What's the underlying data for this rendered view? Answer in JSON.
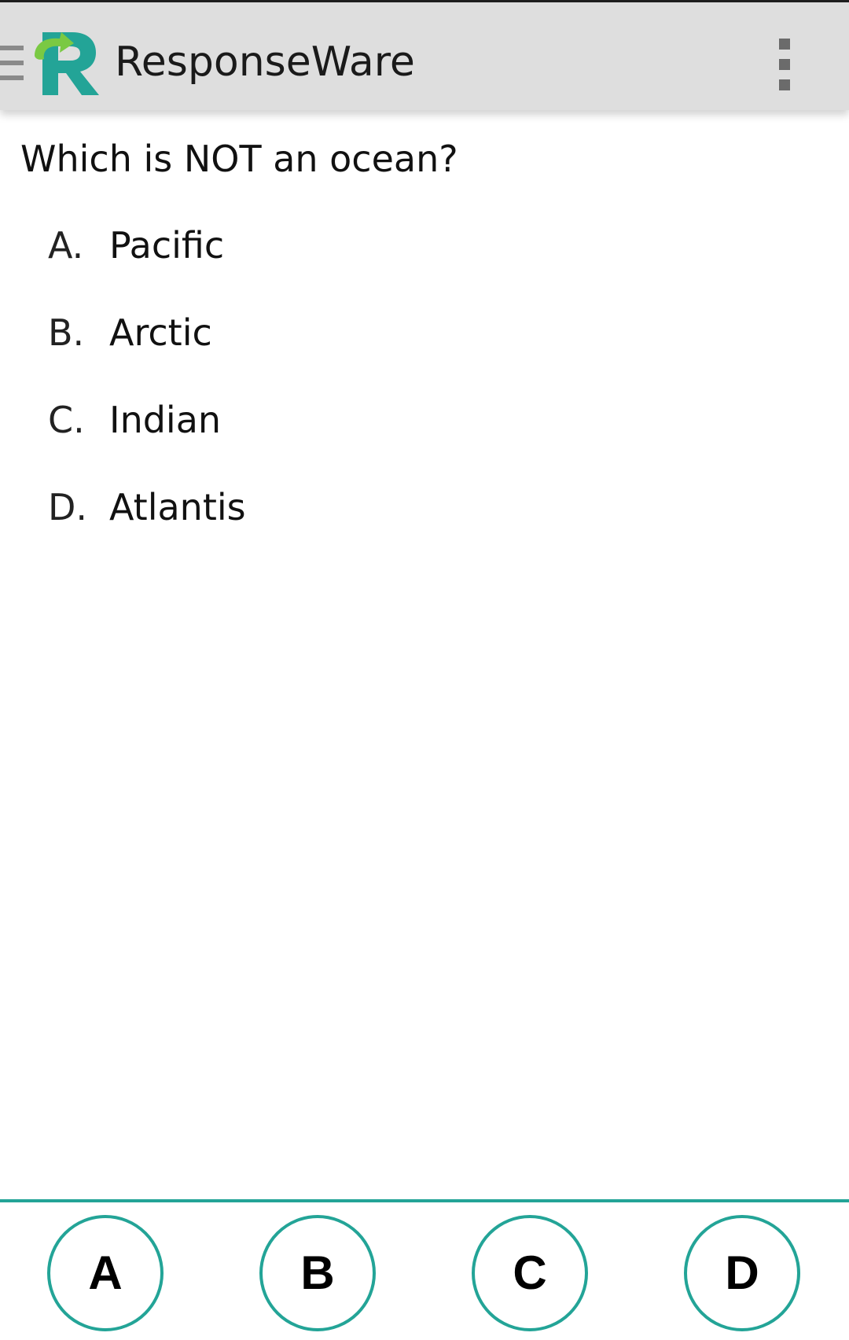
{
  "app": {
    "title": "ResponseWare",
    "icons": {
      "up": "hamburger-up-icon",
      "logo": "responseware-logo-icon",
      "menu": "overflow-menu-icon"
    },
    "colors": {
      "accent": "#23a497",
      "logo_green": "#7ac943",
      "appbar_bg": "#dedede"
    }
  },
  "question": {
    "text": "Which is NOT an ocean?",
    "options": [
      {
        "letter": "A.",
        "text": "Pacific"
      },
      {
        "letter": "B.",
        "text": "Arctic"
      },
      {
        "letter": "C.",
        "text": "Indian"
      },
      {
        "letter": "D.",
        "text": "Atlantis"
      }
    ]
  },
  "answers": {
    "buttons": [
      {
        "label": "A"
      },
      {
        "label": "B"
      },
      {
        "label": "C"
      },
      {
        "label": "D"
      }
    ]
  }
}
